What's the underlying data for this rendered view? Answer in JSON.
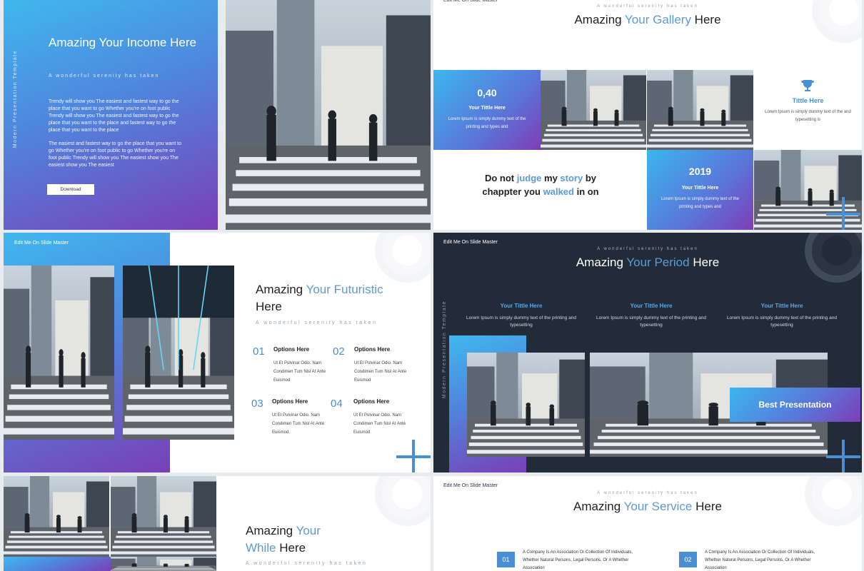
{
  "colors": {
    "accent": "#5b9bd5",
    "navy": "#222b38",
    "gradient_start": "#3fb8ee",
    "gradient_end": "#7a3fb8"
  },
  "master_label": "Edit Me On Slide Master",
  "vertical_label": "Modern Presentation Template",
  "tagline": "A wonderful serenity has taken",
  "slide1": {
    "title": "Amazing Your Income Here",
    "paragraph1": "Trendy will show you The easiest and fastest way to go the place that you want to go Whether you're on foot public Trendy will show you The easiest and fastest way to go the place that you want to the place and fastest way to go the place that you want to the place",
    "paragraph2": "The easiest and fastest way to go the place that you want to go Whether you're on foot public to go Whether you're on foot public Trendy will show you The easiest show you The easiest show you The easiest",
    "button": "Download"
  },
  "slide3": {
    "title_pre": "Amazing ",
    "title_accent": "Your Gallery",
    "title_post": " Here",
    "tile1": {
      "number": "0,40",
      "subtitle": "Your Tittle Here",
      "body": "Lorem Ipsum is simply dummy text of the printing and types and"
    },
    "tile2": {
      "subtitle": "Tittle Here",
      "body": "Lorem Ipsum is simply dummy text of the and typesetting is"
    },
    "tile3": {
      "number": "2019",
      "subtitle": "Your Tittle Here",
      "body": "Lorem Ipsum is simply dummy text of the printing and types and"
    },
    "quote": {
      "w1": "Do not ",
      "w2": "judge",
      "w3": " my ",
      "w4": "story",
      "w5": " by",
      "w6": "chappter you ",
      "w7": "walked",
      "w8": " in on"
    }
  },
  "slide4": {
    "title_pre": "Amazing ",
    "title_accent": "Your Futuristic",
    "title_post": "Here",
    "options": [
      {
        "num": "01",
        "head": "Options Here",
        "body": "Ut Et Pulvinar Odio. Nam Condimen Tum Nisl At Ante Euismod"
      },
      {
        "num": "02",
        "head": "Options Here",
        "body": "Ut Et Pulvinar Odio. Nam Condimen Tum Nisl At Ante Euismod"
      },
      {
        "num": "03",
        "head": "Options Here",
        "body": "Ut Et Pulvinar Odio. Nam Condimen Tum Nisl At Ante Euismod."
      },
      {
        "num": "04",
        "head": "Options Here",
        "body": "Ut Et Pulvinar Odio. Nam Condimen Tum Nisl At Ante Euismod"
      }
    ]
  },
  "slide5": {
    "title_pre": "Amazing ",
    "title_accent": "Your Period",
    "title_post": " Here",
    "columns": [
      {
        "title": "Your Tittle Here",
        "body": "Lorem Ipsum is simply dummy text of the printing and typesetting"
      },
      {
        "title": "Your Tittle Here",
        "body": "Lorem Ipsum is simply dummy text of the printing and typesetting"
      },
      {
        "title": "Your Tittle Here",
        "body": "Lorem Ipsum is simply dummy text of the printing and typesetting"
      }
    ],
    "badge": "Best Presentation"
  },
  "slide6": {
    "title_pre": "Amazing ",
    "title_accent1": "Your",
    "title_accent2": "While",
    "title_post": " Here"
  },
  "slide7": {
    "title_pre": "Amazing ",
    "title_accent": "Your Service",
    "title_post": " Here",
    "items": [
      {
        "num": "01",
        "body": "A Company Is An Association Or Collection Of Individuals, Whether Natural Persons, Legal Persons, Or A Whether Association"
      },
      {
        "num": "02",
        "body": "A Company Is An Association Or Collection Of Individuals, Whether Natural Persons, Legal Persons, Or A Whether Association"
      }
    ]
  }
}
